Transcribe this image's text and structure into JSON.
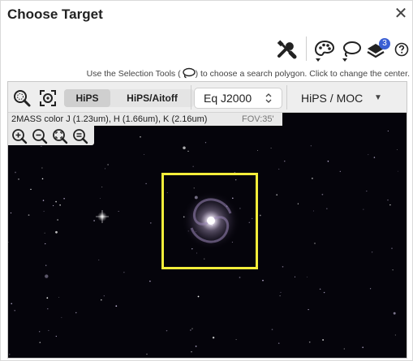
{
  "dialog": {
    "title": "Choose Target",
    "close_label": "✕"
  },
  "toolbar": {
    "icons": [
      "tools-icon",
      "color-palette-icon",
      "lasso-select-icon",
      "layers-icon",
      "help-icon"
    ],
    "layers_count": "3"
  },
  "hint": {
    "before": "Use the Selection Tools (",
    "after": ") to choose a search polygon. Click to change the center."
  },
  "viewer": {
    "projection_tabs": [
      "HiPS",
      "HiPS/Aitoff"
    ],
    "selected_projection": "HiPS",
    "coord_system": "Eq J2000",
    "coord_arrow": "⌃⌄",
    "layer_menu": "HiPS / MOC",
    "layer_menu_arrow": "▼",
    "survey": "2MASS color J (1.23um), H (1.66um), K (2.16um)",
    "fov": "FOV:35'"
  },
  "colors": {
    "target_box": "#f4ee3a",
    "sky_background": "#05040b",
    "badge": "#3a5fd4"
  }
}
